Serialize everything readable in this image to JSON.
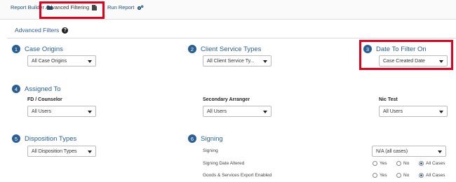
{
  "tabs": {
    "report_builder": "Report Builder",
    "advanced_filtering": "Advanced Filtering",
    "run_report": "Run Report"
  },
  "panel_title": "Advanced Filters",
  "help_glyph": "?",
  "sections": {
    "case_origins": {
      "num": "1",
      "label": "Case Origins",
      "select": "All Case Origins"
    },
    "client_service_types": {
      "num": "2",
      "label": "Client Service Types",
      "select": "All Client Service Ty..."
    },
    "date_to_filter_on": {
      "num": "3",
      "label": "Date To Filter On",
      "select": "Case Created Date"
    },
    "assigned_to": {
      "num": "4",
      "label": "Assigned To"
    },
    "disposition_types": {
      "num": "5",
      "label": "Disposition Types",
      "select": "All Disposition Types"
    },
    "signing": {
      "num": "6",
      "label": "Signing"
    }
  },
  "assigned_to": {
    "fd_counselor": {
      "label": "FD / Counselor",
      "select": "All Users"
    },
    "secondary_arranger": {
      "label": "Secondary Arranger",
      "select": "All Users"
    },
    "nic_test": {
      "label": "Nic Test",
      "select": "All Users"
    }
  },
  "signing": {
    "signing_label": "Signing",
    "signing_select": "N/A (all cases)",
    "date_altered_label": "Signing Date Altered",
    "goods_services_label": "Goods & Services Export Enabled",
    "options": {
      "yes": "Yes",
      "no": "No",
      "all": "All Cases"
    }
  },
  "colors": {
    "accent": "#2a5f93",
    "highlight": "#e3001b"
  }
}
